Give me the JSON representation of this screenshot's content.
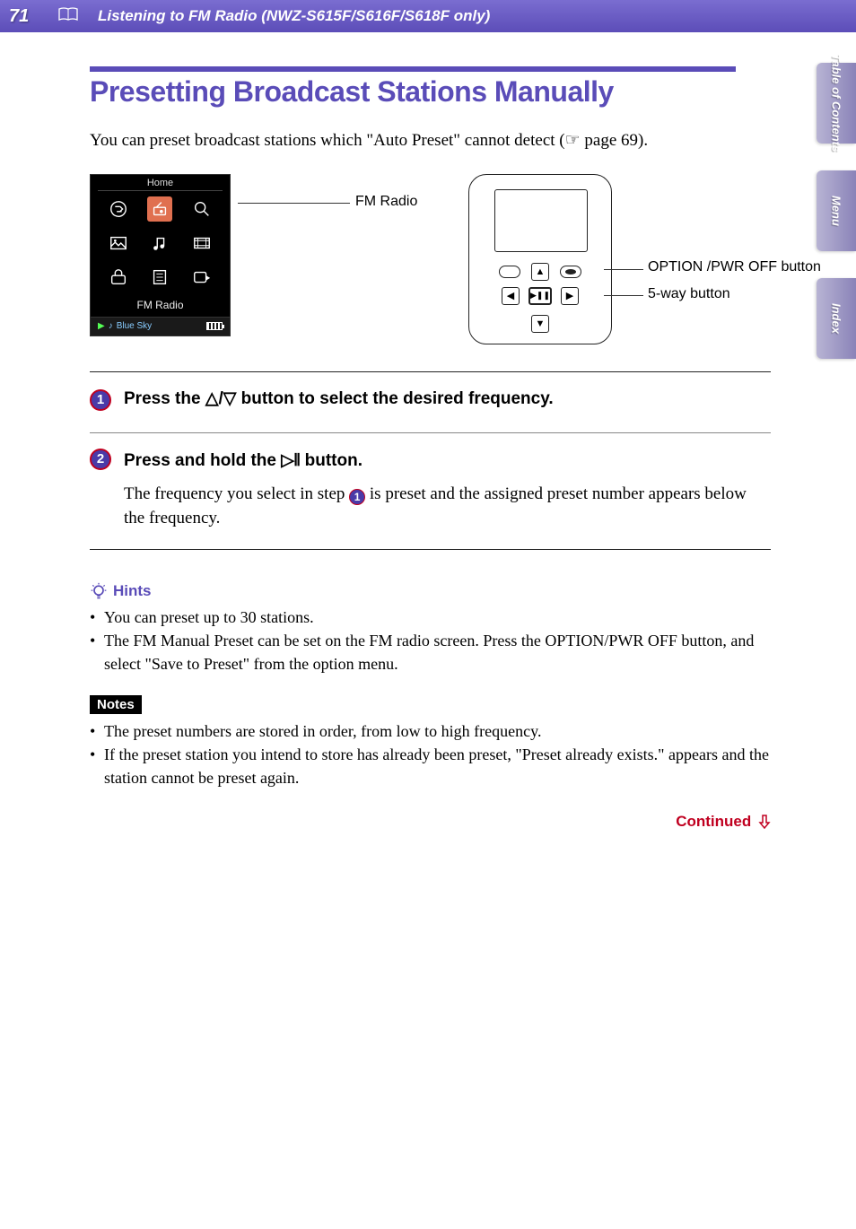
{
  "header": {
    "page_number": "71",
    "chapter_title": "Listening to FM Radio (NWZ-S615F/S616F/S618F only)"
  },
  "side_tabs": {
    "contents": "Table of Contents",
    "menu": "Menu",
    "index": "Index"
  },
  "title": "Presetting Broadcast Stations Manually",
  "intro_pre": "You can preset broadcast stations which \"Auto Preset\" cannot detect (",
  "intro_page_ref": " page 69).",
  "figure": {
    "home_title": "Home",
    "home_menu_label": "FM Radio",
    "now_playing": "Blue Sky",
    "callout_fm": "FM Radio",
    "callout_option": "OPTION /PWR OFF button",
    "callout_fiveway": "5-way button"
  },
  "steps": {
    "s1": {
      "num": "1",
      "head_pre": "Press the ",
      "head_symbol": "△/▽",
      "head_post": " button to select the desired frequency."
    },
    "s2": {
      "num": "2",
      "head_pre": "Press and hold the ",
      "head_symbol": "▷𝍪",
      "head_post": " button.",
      "body_pre": "The frequency you select in step ",
      "body_num": "1",
      "body_post": " is preset and the assigned preset number appears below the frequency."
    }
  },
  "hints": {
    "title": "Hints",
    "items": [
      "You can preset up to 30 stations.",
      "The FM Manual Preset can be set on the FM radio screen. Press the OPTION/PWR OFF button, and select \"Save to Preset\" from the option menu."
    ]
  },
  "notes": {
    "title": "Notes",
    "items": [
      "The preset numbers are stored in order, from low to high frequency.",
      "If the preset station you intend to store has already been preset, \"Preset already exists.\" appears and the station cannot be preset again."
    ]
  },
  "continued": "Continued"
}
